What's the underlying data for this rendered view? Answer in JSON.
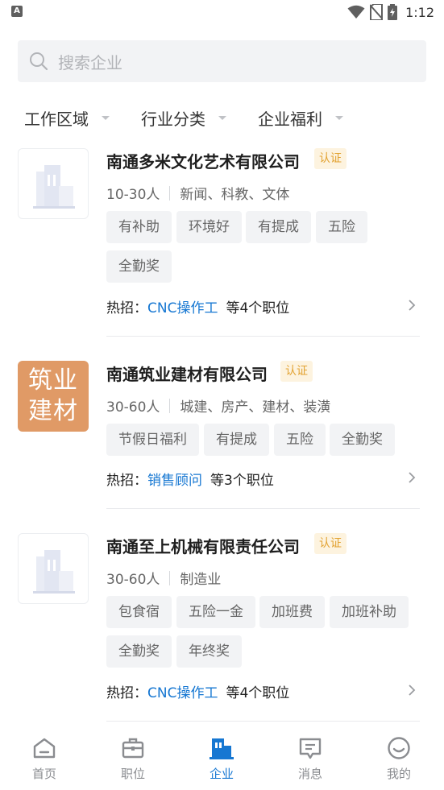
{
  "status_bar": {
    "time": "1:12",
    "badge": "A"
  },
  "search": {
    "placeholder": "搜索企业"
  },
  "filters": [
    {
      "label": "工作区域"
    },
    {
      "label": "行业分类"
    },
    {
      "label": "企业福利"
    }
  ],
  "companies": [
    {
      "name": "南通多米文化艺术有限公司",
      "badge": "认证",
      "size": "10-30人",
      "industry": "新闻、科教、文体",
      "tags": [
        "有补助",
        "环境好",
        "有提成",
        "五险",
        "全勤奖"
      ],
      "hot_prefix": "热招：",
      "hot_job": "CNC操作工",
      "hot_count": "等4个职位",
      "logo": "placeholder"
    },
    {
      "name": "南通筑业建材有限公司",
      "badge": "认证",
      "size": "30-60人",
      "industry": "城建、房产、建材、装潢",
      "tags": [
        "节假日福利",
        "有提成",
        "五险",
        "全勤奖"
      ],
      "hot_prefix": "热招：",
      "hot_job": "销售顾问",
      "hot_count": "等3个职位",
      "logo": "text",
      "logo_line1": "筑业",
      "logo_line2": "建材",
      "logo_color": "#e09a66"
    },
    {
      "name": "南通至上机械有限责任公司",
      "badge": "认证",
      "size": "30-60人",
      "industry": "制造业",
      "tags": [
        "包食宿",
        "五险一金",
        "加班费",
        "加班补助",
        "全勤奖",
        "年终奖"
      ],
      "hot_prefix": "热招：",
      "hot_job": "CNC操作工",
      "hot_count": "等4个职位",
      "logo": "placeholder"
    }
  ],
  "tabbar": {
    "active": "企业",
    "accent_color": "#1677d2",
    "items": [
      {
        "label": "首页",
        "icon": "home-icon"
      },
      {
        "label": "职位",
        "icon": "briefcase-icon"
      },
      {
        "label": "企业",
        "icon": "building-icon"
      },
      {
        "label": "消息",
        "icon": "message-icon"
      },
      {
        "label": "我的",
        "icon": "profile-icon"
      }
    ]
  }
}
